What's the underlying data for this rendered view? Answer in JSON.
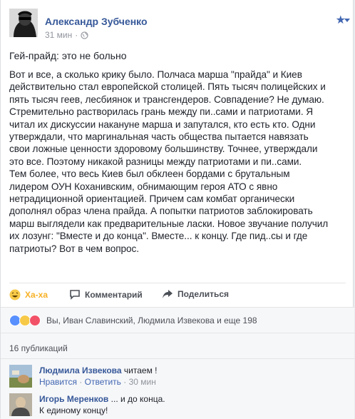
{
  "post": {
    "author": "Александр Зубченко",
    "time": "31 мин",
    "title": "Гей-прайд: это не больно",
    "body_lines": [
      "Вот и все, а сколько крику было. Полчаса марша \"прайда\" и Киев",
      "действительно стал европейской столицей. Пять тысяч полицейских и",
      "пять тысяч геев, лесбиянок и трансгендеров. Совпадение? Не думаю.",
      "Стремительно растворилась грань между пи..сами и патриотами. Я",
      "читал их дискуссии накануне марша и запутался, кто есть кто. Одни",
      "утверждали, что маргинальная часть общества пытается навязать",
      "свои ложные ценности здоровому большинству. Точнее, утверждали",
      "это все. Поэтому никакой разницы между патриотами и пи..сами.",
      "Тем более, что весь Киев был обклеен бордами с брутальным",
      "лидером ОУН Коханивским, обнимающим героя АТО с явно",
      "нетрадиционной ориентацией. Причем сам комбат органически",
      "дополнял образ члена прайда. А попытки патриотов заблокировать",
      "марш выглядели как предварительные ласки. Новое звучание получил",
      "их лозунг: \"Вместе и до конца\". Вместе... к концу. Где пид..сы и где",
      "патриоты? Вот в чем вопрос."
    ]
  },
  "actions": {
    "haha": "Ха-ха",
    "comment": "Комментарий",
    "share": "Поделиться"
  },
  "reactions": {
    "text": "Вы, Иван Славинский, Людмила Извекова и еще 198"
  },
  "shares": {
    "text": "16 публикаций"
  },
  "comments": [
    {
      "author": "Людмила Извекова",
      "text": " читаем !",
      "like": "Нравится",
      "reply": "Ответить",
      "time": "30 мин"
    },
    {
      "author": "Игорь Меренков",
      "text": " ... и до конца.",
      "text2": "К единому концу!"
    }
  ],
  "colors": {
    "link": "#365899",
    "accent": "#4267b2",
    "haha": "#f7b125",
    "muted": "#90949c"
  }
}
